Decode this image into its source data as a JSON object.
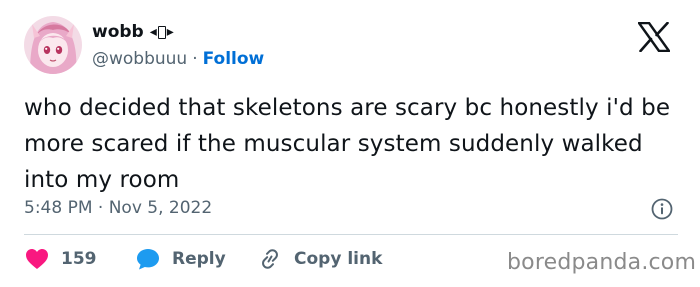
{
  "author": {
    "name": "wobb",
    "handle": "@wobbuuu",
    "separator": "·",
    "follow_label": "Follow",
    "badge_left": "◂",
    "badge_right": "▸"
  },
  "tweet": {
    "text": "who decided that skeletons are scary bc honestly i'd be more scared if the muscular system suddenly walked into my room",
    "timestamp": "5:48 PM · Nov 5, 2022"
  },
  "actions": {
    "like_count": "159",
    "reply_label": "Reply",
    "copy_link_label": "Copy link"
  },
  "icons": {
    "heart": "heart-icon",
    "reply": "speech-bubble-icon",
    "copy": "link-icon",
    "info": "info-icon",
    "brand": "x-logo-icon"
  },
  "colors": {
    "heart": "#f91880",
    "reply": "#1d9bf0",
    "follow": "#006fd6",
    "secondary_text": "#536471",
    "watermark": "#8a8a8a"
  },
  "watermark": "boredpanda.com"
}
